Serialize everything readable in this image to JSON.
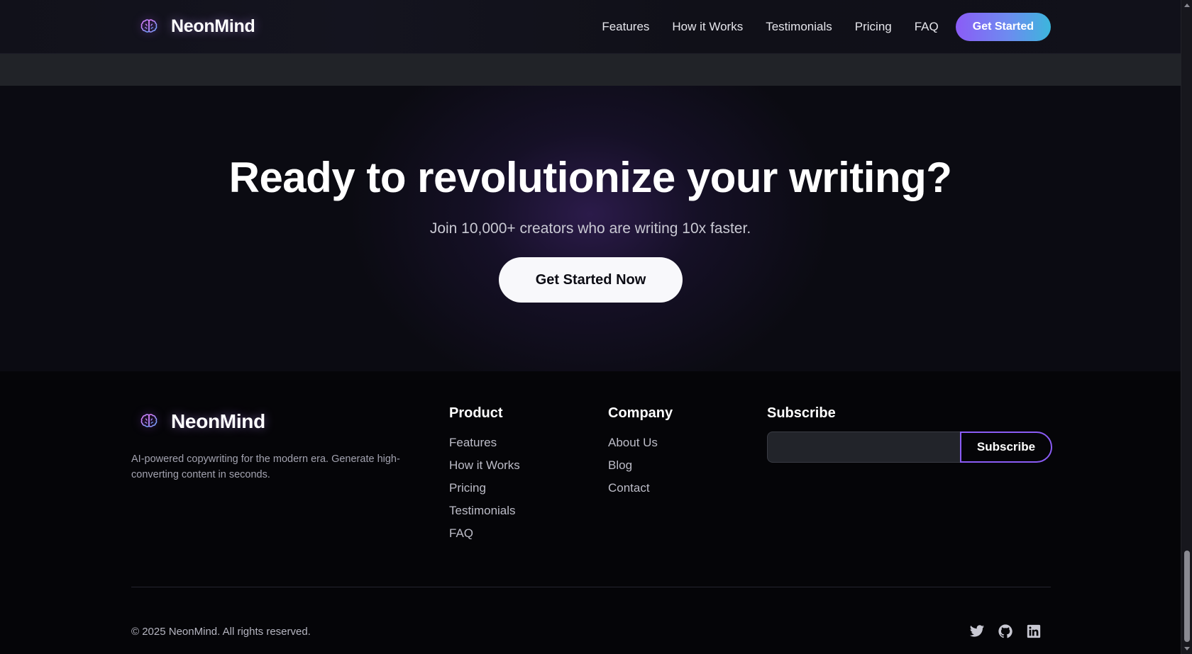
{
  "header": {
    "brand": "NeonMind",
    "nav": [
      {
        "label": "Features"
      },
      {
        "label": "How it Works"
      },
      {
        "label": "Testimonials"
      },
      {
        "label": "Pricing"
      },
      {
        "label": "FAQ"
      }
    ],
    "cta_label": "Get Started"
  },
  "cta": {
    "title": "Ready to revolutionize your writing?",
    "subtitle": "Join 10,000+ creators who are writing 10x faster.",
    "button_label": "Get Started Now"
  },
  "footer": {
    "brand": "NeonMind",
    "description": "AI-powered copywriting for the modern era. Generate high-converting content in seconds.",
    "product": {
      "title": "Product",
      "links": [
        "Features",
        "How it Works",
        "Pricing",
        "Testimonials",
        "FAQ"
      ]
    },
    "company": {
      "title": "Company",
      "links": [
        "About Us",
        "Blog",
        "Contact"
      ]
    },
    "subscribe": {
      "title": "Subscribe",
      "input_value": "",
      "button_label": "Subscribe"
    },
    "copyright": "© 2025 NeonMind. All rights reserved.",
    "socials": [
      "twitter-icon",
      "github-icon",
      "linkedin-icon"
    ]
  },
  "colors": {
    "accent_purple": "#8b5cf6",
    "accent_cyan": "#3cb6dc",
    "background": "#050508"
  }
}
